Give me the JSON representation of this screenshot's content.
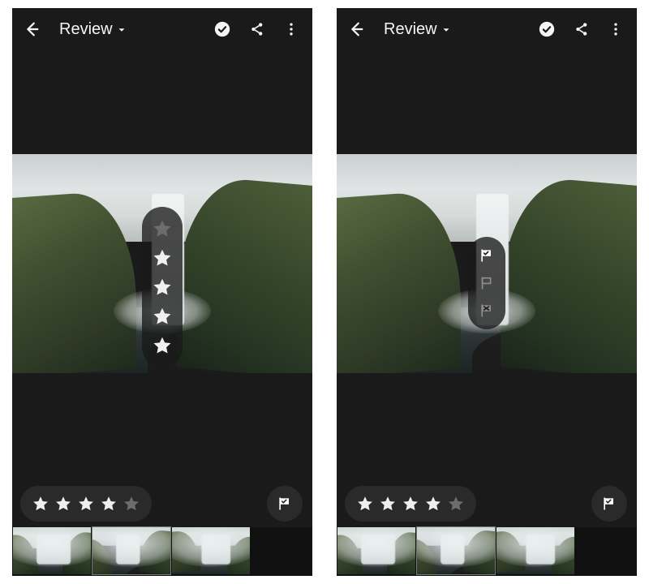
{
  "header": {
    "title": "Review"
  },
  "left_screen": {
    "overlay": {
      "type": "stars",
      "count": 5,
      "selected": 4
    },
    "rating_stars_filled": 4,
    "rating_stars_total": 5
  },
  "right_screen": {
    "overlay": {
      "type": "flags",
      "options": [
        "pick",
        "unflagged",
        "reject"
      ],
      "selected": "pick"
    },
    "rating_stars_filled": 4,
    "rating_stars_total": 5
  },
  "colors": {
    "bg": "#1a1a1a",
    "star_on": "#f0f0f0",
    "star_off": "#6d6d6d",
    "pill": "rgba(25,25,25,0.78)"
  }
}
